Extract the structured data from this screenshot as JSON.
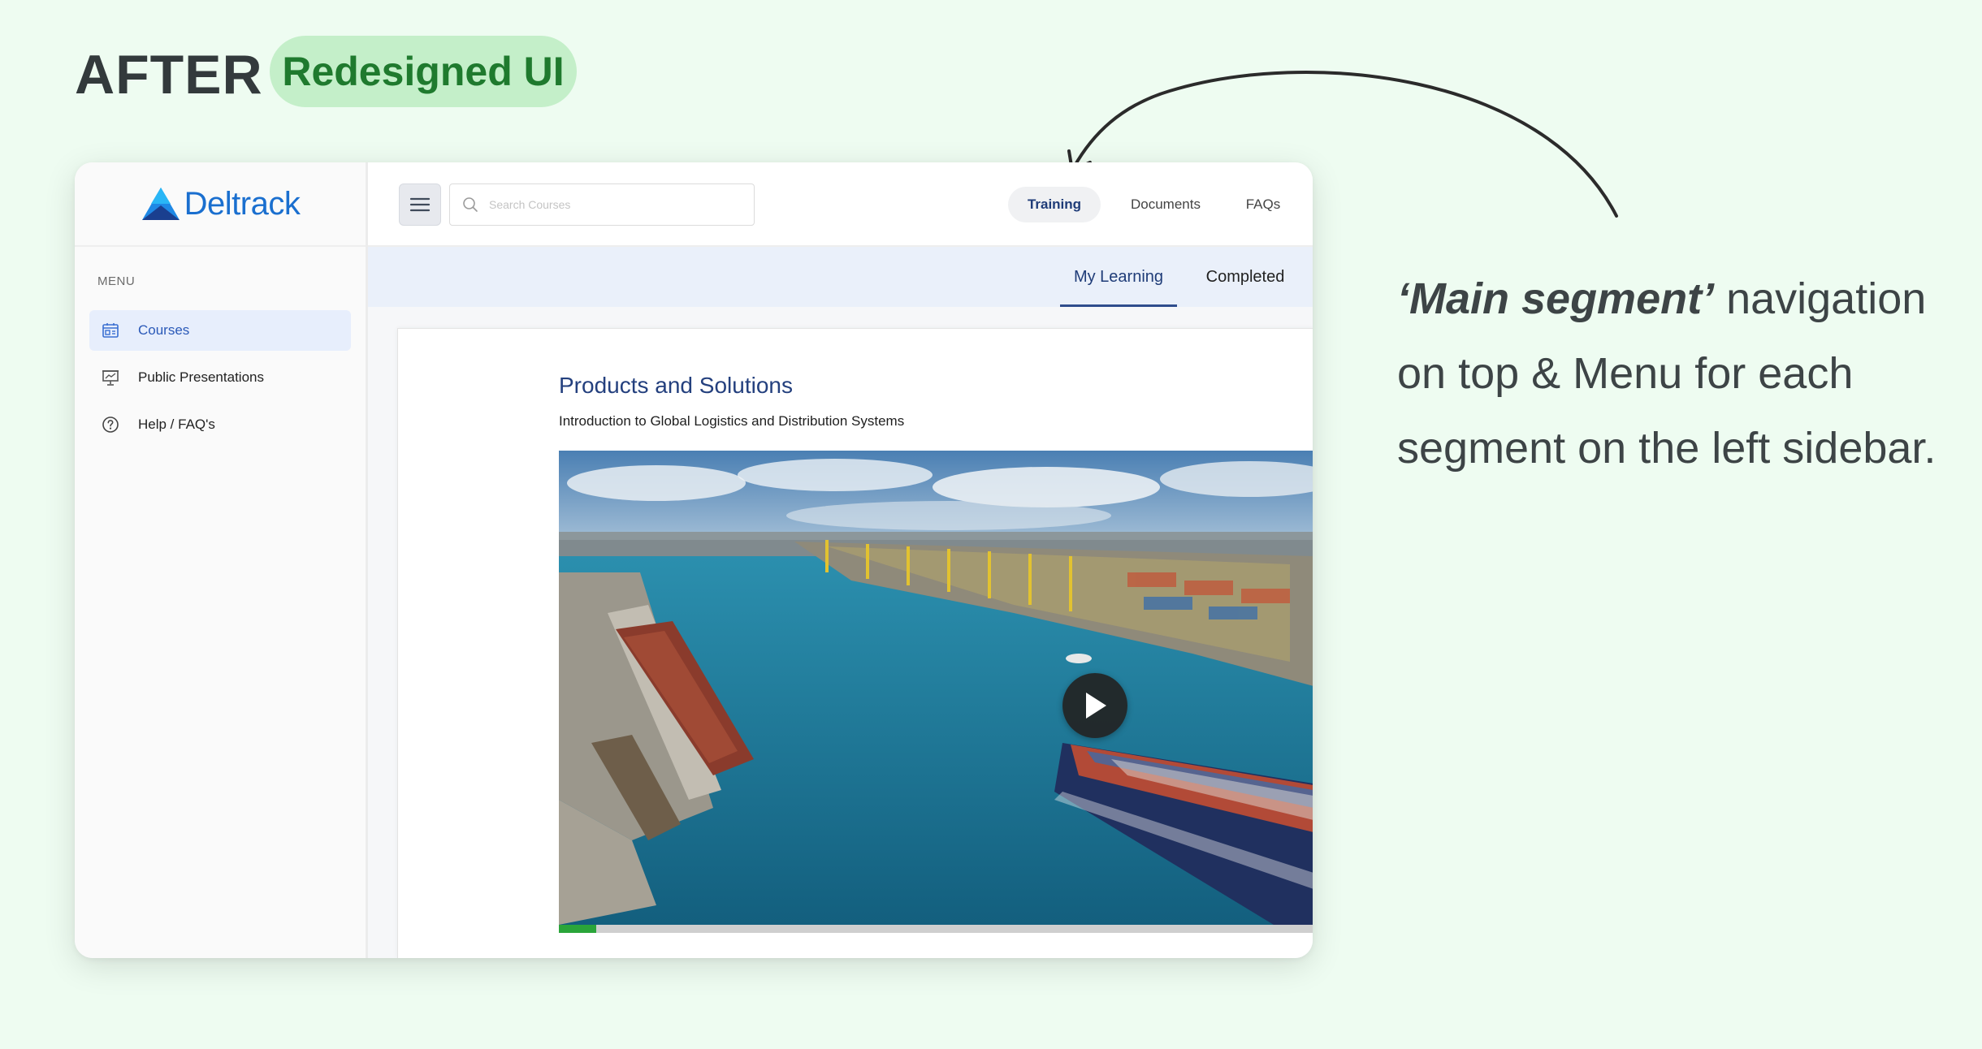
{
  "slide": {
    "title": "AFTER",
    "badge": "Redesigned UI"
  },
  "annotation": {
    "emphasis": "‘Main segment’",
    "text": " navigation on top & Menu  for each segment on the left sidebar."
  },
  "app": {
    "brand": {
      "name": "Deltrack",
      "logo_icon": "delta-triangle-logo",
      "color": "#1a6fcf"
    },
    "sidebar": {
      "heading": "MENU",
      "items": [
        {
          "label": "Courses",
          "icon": "courses-icon",
          "active": true
        },
        {
          "label": "Public Presentations",
          "icon": "presentation-icon",
          "active": false
        },
        {
          "label": "Help / FAQ's",
          "icon": "help-icon",
          "active": false
        }
      ]
    },
    "topbar": {
      "menu_icon": "hamburger-icon",
      "search": {
        "placeholder": "Search Courses",
        "value": ""
      },
      "tabs": [
        {
          "label": "Training",
          "active": true
        },
        {
          "label": "Documents",
          "active": false
        },
        {
          "label": "FAQs",
          "active": false
        }
      ]
    },
    "subtabs": [
      {
        "label": "My Learning",
        "active": true
      },
      {
        "label": "Completed",
        "active": false
      }
    ],
    "course": {
      "title": "Products and Solutions",
      "subtitle": "Introduction to Global Logistics and Distribution Systems"
    },
    "video": {
      "progress_percent": 5,
      "play_icon": "play-icon",
      "progress_color": "#2aa53a"
    }
  },
  "colors": {
    "background": "#eefcf1",
    "badge_bg": "#c4efc9",
    "badge_text": "#1f7a2e",
    "active_blue": "#1f3c78"
  }
}
